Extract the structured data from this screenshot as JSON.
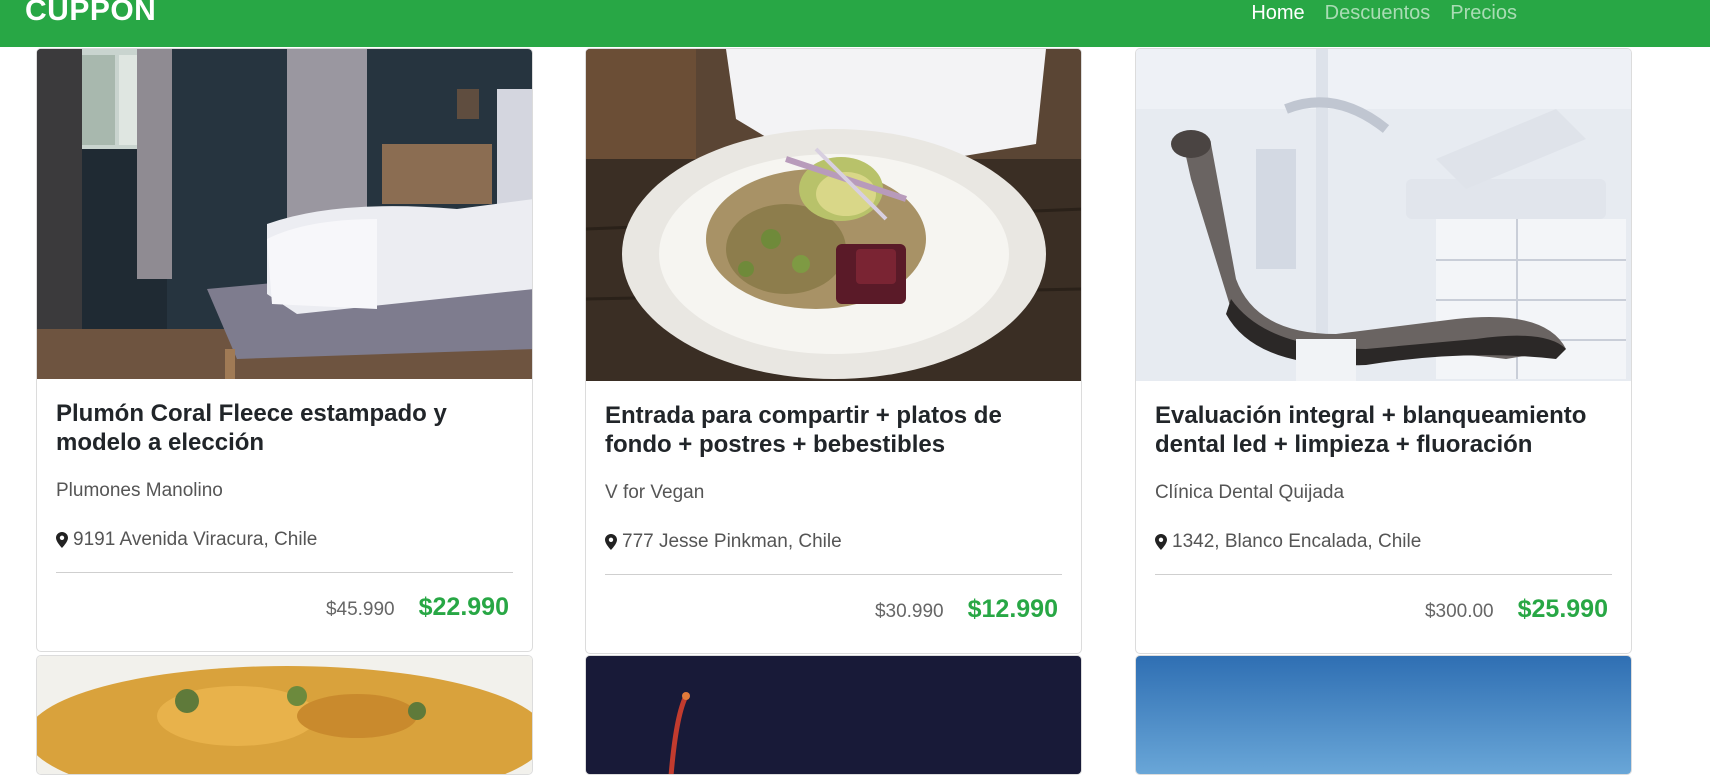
{
  "header": {
    "brand": "CUPPON",
    "nav": [
      {
        "label": "Home",
        "active": true
      },
      {
        "label": "Descuentos",
        "active": false
      },
      {
        "label": "Precios",
        "active": false
      }
    ]
  },
  "cards": [
    {
      "title": "Plumón Coral Fleece estampado y modelo a elección",
      "vendor": "Plumones Manolino",
      "location": "9191 Avenida Viracura, Chile",
      "old_price": "$45.990",
      "new_price": "$22.990",
      "image": "bedroom-photo"
    },
    {
      "title": "Entrada para compartir + platos de fondo + postres + bebestibles",
      "vendor": "V for Vegan",
      "location": "777 Jesse Pinkman, Chile",
      "old_price": "$30.990",
      "new_price": "$12.990",
      "image": "vegan-dish-photo"
    },
    {
      "title": "Evaluación integral + blanqueamiento dental led + limpieza + fluoración",
      "vendor": "Clínica Dental Quijada",
      "location": "1342, Blanco Encalada, Chile",
      "old_price": "$300.00",
      "new_price": "$25.990",
      "image": "dental-chair-photo"
    }
  ],
  "colors": {
    "brand_green": "#28a745",
    "text_dark": "#212529",
    "text_muted": "#555555"
  }
}
